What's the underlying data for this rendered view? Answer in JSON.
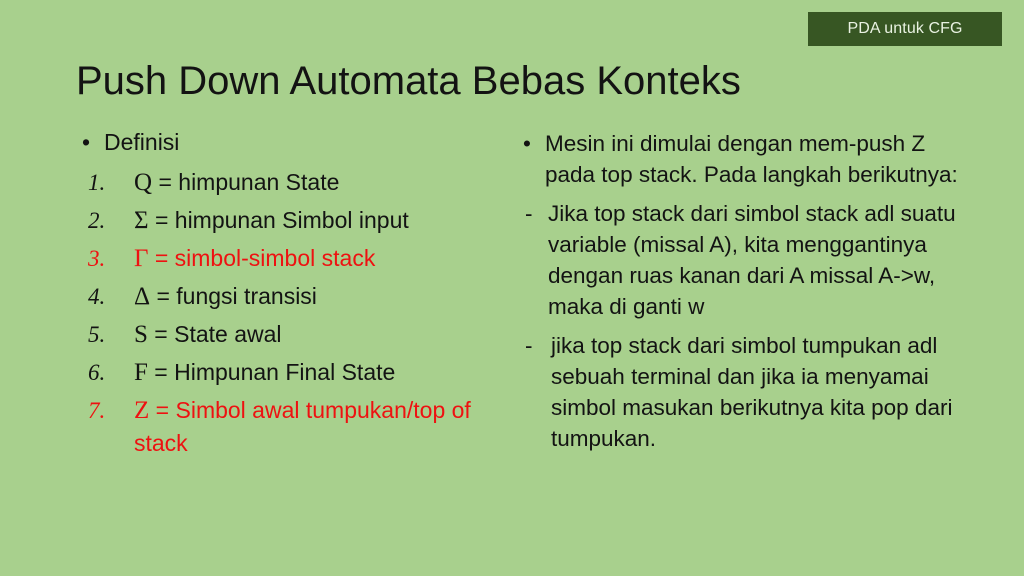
{
  "badge": {
    "label": "PDA untuk CFG",
    "bg_color": "#375623",
    "text_color": "#e9f2e2"
  },
  "slide": {
    "background_color": "#a8d08d",
    "title": "Push Down Automata Bebas Konteks",
    "title_color": "#131313"
  },
  "left_column": {
    "bullet_marker": "•",
    "heading": "Definisi",
    "items": [
      {
        "number": "1.",
        "symbol": "Q",
        "text": "= himpunan State",
        "color": "#131313"
      },
      {
        "number": "2.",
        "symbol": "Σ",
        "text": "= himpunan Simbol input",
        "color": "#131313"
      },
      {
        "number": "3.",
        "symbol": "Γ",
        "text": "= simbol-simbol stack",
        "color": "#ee1111"
      },
      {
        "number": "4.",
        "symbol": "Δ",
        "text": "= fungsi transisi",
        "color": "#131313"
      },
      {
        "number": "5.",
        "symbol": "S",
        "text": "= State awal",
        "color": "#131313"
      },
      {
        "number": "6.",
        "symbol": "F",
        "text": "= Himpunan Final State",
        "color": "#131313"
      },
      {
        "number": "7.",
        "symbol": "Z",
        "text": "= Simbol awal tumpukan/top of stack",
        "color": "#ee1111"
      }
    ]
  },
  "right_column": {
    "paragraphs": [
      {
        "marker": "•",
        "text": "Mesin ini dimulai dengan mem-push Z pada top stack. Pada langkah berikutnya:"
      },
      {
        "marker": "-",
        "text": "Jika top stack dari simbol stack adl suatu variable (missal A), kita menggantinya dengan ruas kanan dari A missal A->w, maka di ganti w"
      },
      {
        "marker": "-",
        "text": "jika top stack dari simbol tumpukan adl sebuah terminal dan jika ia menyamai simbol masukan berikutnya kita pop dari tumpukan."
      }
    ]
  }
}
